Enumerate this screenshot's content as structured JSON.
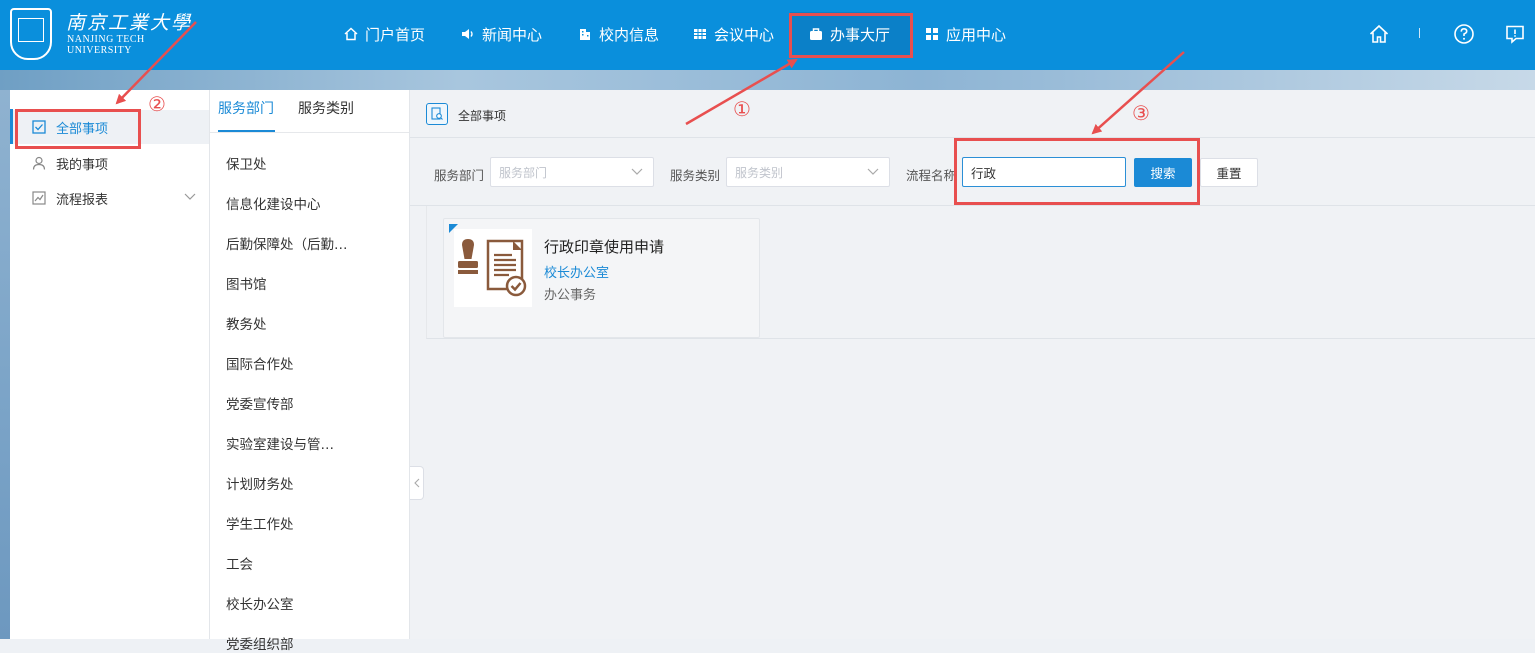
{
  "logo": {
    "cn": "南京工業大學",
    "en_line1": "NANJING TECH",
    "en_line2": "UNIVERSITY"
  },
  "nav": [
    {
      "label": "门户首页",
      "icon": "home-outline-icon"
    },
    {
      "label": "新闻中心",
      "icon": "speaker-icon"
    },
    {
      "label": "校内信息",
      "icon": "building-icon"
    },
    {
      "label": "会议中心",
      "icon": "table-grid-icon"
    },
    {
      "label": "办事大厅",
      "icon": "briefcase-icon",
      "active": true
    },
    {
      "label": "应用中心",
      "icon": "apps-grid-icon"
    }
  ],
  "header_icons": [
    "home-icon",
    "help-icon",
    "feedback-icon"
  ],
  "sidebar": {
    "items": [
      {
        "label": "全部事项",
        "icon": "checkbox-icon",
        "active": true
      },
      {
        "label": "我的事项",
        "icon": "user-icon"
      },
      {
        "label": "流程报表",
        "icon": "chart-icon",
        "expandable": true
      }
    ]
  },
  "service_tabs": [
    {
      "label": "服务部门",
      "active": true
    },
    {
      "label": "服务类别"
    }
  ],
  "departments": [
    "保卫处",
    "信息化建设中心",
    "后勤保障处（后勤…",
    "图书馆",
    "教务处",
    "国际合作处",
    "党委宣传部",
    "实验室建设与管…",
    "计划财务处",
    "学生工作处",
    "工会",
    "校长办公室",
    "党委组织部"
  ],
  "main": {
    "title": "全部事项",
    "filters": {
      "dept_label": "服务部门",
      "dept_placeholder": "服务部门",
      "category_label": "服务类别",
      "category_placeholder": "服务类别",
      "name_label": "流程名称",
      "name_value": "行政",
      "search_label": "搜索",
      "reset_label": "重置"
    },
    "results": [
      {
        "title": "行政印章使用申请",
        "department": "校长办公室",
        "category": "办公事务",
        "icon": "stamp-document-icon"
      }
    ]
  },
  "annotations": {
    "one": "①",
    "two": "②",
    "three": "③"
  },
  "colors": {
    "header": "#0a8fdc",
    "accent": "#1b8ad6",
    "annotation": "#e84f4f"
  }
}
